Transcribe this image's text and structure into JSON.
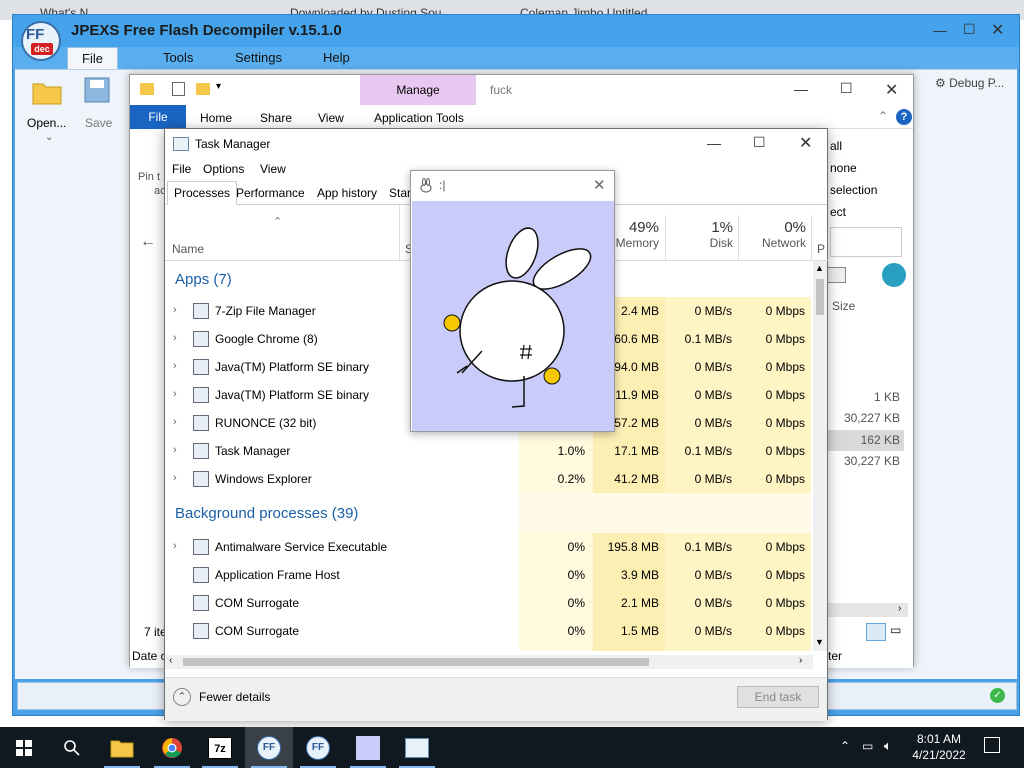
{
  "browser": {
    "tabs": [
      "What's N",
      "Downloaded by Dusting Sou...",
      "Coleman Jimbo Untitled"
    ]
  },
  "ffdec": {
    "title": "JPEXS Free Flash Decompiler v.15.1.0",
    "logo_text": "FF",
    "logo_sub": "dec",
    "menu": [
      "File",
      "Tools",
      "Settings",
      "Help"
    ],
    "ribbon": {
      "open": "Open...",
      "save": "Save",
      "debug": "Debug P..."
    }
  },
  "explorer": {
    "title": "fuck",
    "manage": "Manage",
    "tabs": {
      "file": "File",
      "home": "Home",
      "share": "Share",
      "view": "View",
      "app_tools": "Application Tools"
    },
    "right_panel": [
      "all",
      "none",
      "selection",
      "ect"
    ],
    "pin_partial": [
      "Pin t",
      "ac"
    ],
    "size_header": "Size",
    "sizes": [
      "1 KB",
      "30,227 KB",
      "162 KB",
      "30,227 KB"
    ],
    "items_count": "7 ite",
    "date_partial": "Date c",
    "ter_partial": "ter"
  },
  "taskmgr": {
    "title": "Task Manager",
    "menu": [
      "File",
      "Options",
      "View"
    ],
    "tabs": [
      "Processes",
      "Performance",
      "App history",
      "Star"
    ],
    "columns": {
      "name": "Name",
      "status_partial": "S",
      "memory": {
        "pct": "49%",
        "label": "Memory"
      },
      "disk": {
        "pct": "1%",
        "label": "Disk"
      },
      "network": {
        "pct": "0%",
        "label": "Network"
      },
      "p_partial": "P"
    },
    "apps_header": "Apps (7)",
    "apps": [
      {
        "name": "7-Zip File Manager",
        "cpu": "",
        "mem": "2.4 MB",
        "disk": "0 MB/s",
        "net": "0 Mbps"
      },
      {
        "name": "Google Chrome (8)",
        "cpu": "",
        "mem": "60.6 MB",
        "disk": "0.1 MB/s",
        "net": "0 Mbps"
      },
      {
        "name": "Java(TM) Platform SE binary",
        "cpu": "",
        "mem": "94.0 MB",
        "disk": "0 MB/s",
        "net": "0 Mbps"
      },
      {
        "name": "Java(TM) Platform SE binary",
        "cpu": "",
        "mem": "611.9 MB",
        "disk": "0 MB/s",
        "net": "0 Mbps"
      },
      {
        "name": "RUNONCE (32 bit)",
        "cpu": "",
        "mem": "57.2 MB",
        "disk": "0 MB/s",
        "net": "0 Mbps"
      },
      {
        "name": "Task Manager",
        "cpu": "1.0%",
        "mem": "17.1 MB",
        "disk": "0.1 MB/s",
        "net": "0 Mbps"
      },
      {
        "name": "Windows Explorer",
        "cpu": "0.2%",
        "mem": "41.2 MB",
        "disk": "0 MB/s",
        "net": "0 Mbps"
      }
    ],
    "bg_header": "Background processes (39)",
    "bg": [
      {
        "name": "Antimalware Service Executable",
        "cpu": "0%",
        "mem": "195.8 MB",
        "disk": "0.1 MB/s",
        "net": "0 Mbps"
      },
      {
        "name": "Application Frame Host",
        "cpu": "0%",
        "mem": "3.9 MB",
        "disk": "0 MB/s",
        "net": "0 Mbps"
      },
      {
        "name": "COM Surrogate",
        "cpu": "0%",
        "mem": "2.1 MB",
        "disk": "0 MB/s",
        "net": "0 Mbps"
      },
      {
        "name": "COM Surrogate",
        "cpu": "0%",
        "mem": "1.5 MB",
        "disk": "0 MB/s",
        "net": "0 Mbps"
      }
    ],
    "fewer_details": "Fewer details",
    "end_task": "End task"
  },
  "popup": {
    "title": ":|"
  },
  "taskbar": {
    "time": "8:01 AM",
    "date": "4/21/2022"
  },
  "colors": {
    "accent": "#0078d7",
    "highlight": "#fff4c4",
    "ffdec_blue": "#44a3ea"
  }
}
